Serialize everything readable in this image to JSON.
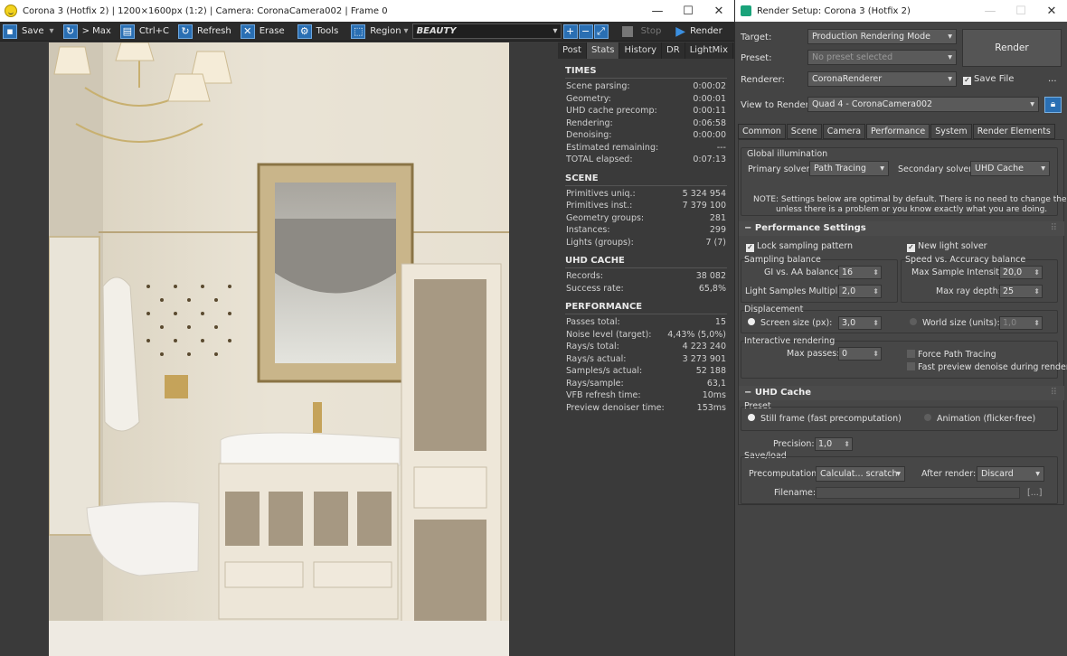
{
  "vfb": {
    "title": "Corona 3 (Hotfix 2) | 1200×1600px (1:2) | Camera: CoronaCamera002 | Frame 0",
    "toolbar": {
      "save": "Save",
      "max": "> Max",
      "copy": "Ctrl+C",
      "refresh": "Refresh",
      "erase": "Erase",
      "tools": "Tools",
      "region": "Region",
      "channel": "BEAUTY",
      "stop": "Stop",
      "render": "Render"
    },
    "tabs": [
      "Post",
      "Stats",
      "History",
      "DR",
      "LightMix"
    ],
    "sections": [
      {
        "title": "TIMES",
        "rows": [
          [
            "Scene parsing:",
            "0:00:02"
          ],
          [
            "Geometry:",
            "0:00:01"
          ],
          [
            "UHD cache precomp:",
            "0:00:11"
          ],
          [
            "Rendering:",
            "0:06:58"
          ],
          [
            "Denoising:",
            "0:00:00"
          ],
          [
            "Estimated remaining:",
            "---"
          ],
          [
            "TOTAL elapsed:",
            "0:07:13"
          ]
        ]
      },
      {
        "title": "SCENE",
        "rows": [
          [
            "Primitives uniq.:",
            "5 324 954"
          ],
          [
            "Primitives inst.:",
            "7 379 100"
          ],
          [
            "Geometry groups:",
            "281"
          ],
          [
            "Instances:",
            "299"
          ],
          [
            "Lights (groups):",
            "7 (7)"
          ]
        ]
      },
      {
        "title": "UHD CACHE",
        "rows": [
          [
            "Records:",
            "38 082"
          ],
          [
            "Success rate:",
            "65,8%"
          ]
        ]
      },
      {
        "title": "PERFORMANCE",
        "rows": [
          [
            "Passes total:",
            "15"
          ],
          [
            "Noise level (target):",
            "4,43% (5,0%)"
          ],
          [
            "Rays/s total:",
            "4 223 240"
          ],
          [
            "Rays/s actual:",
            "3 273 901"
          ],
          [
            "Samples/s actual:",
            "52 188"
          ],
          [
            "Rays/sample:",
            "63,1"
          ],
          [
            "VFB refresh time:",
            "10ms"
          ],
          [
            "Preview denoiser time:",
            "153ms"
          ]
        ]
      }
    ]
  },
  "rs": {
    "title": "Render Setup: Corona 3 (Hotfix 2)",
    "target_label": "Target:",
    "target": "Production Rendering Mode",
    "preset_label": "Preset:",
    "preset": "No preset selected",
    "renderer_label": "Renderer:",
    "renderer": "CoronaRenderer",
    "savefile": "Save File",
    "more": "...",
    "view_label": "View to Render:",
    "view": "Quad 4 - CoronaCamera002",
    "render_btn": "Render",
    "tabs": [
      "Common",
      "Scene",
      "Camera",
      "Performance",
      "System",
      "Render Elements"
    ],
    "gi": {
      "title": "Global illumination",
      "primary_label": "Primary solver:",
      "primary": "Path Tracing",
      "secondary_label": "Secondary solver:",
      "secondary": "UHD Cache",
      "note1": "NOTE: Settings below are optimal by default. There is no need to change them",
      "note2": "unless there is a problem or you know exactly what you are doing."
    },
    "perf": {
      "title": "Performance Settings",
      "lock": "Lock sampling pattern",
      "newlight": "New light solver",
      "sb": "Sampling balance",
      "sva": "Speed vs. Accuracy balance",
      "gi_aa_label": "GI vs. AA balance:",
      "gi_aa": "16",
      "maxint_label": "Max Sample Intensity:",
      "maxint": "20,0",
      "lsm_label": "Light Samples Multiplier:",
      "lsm": "2,0",
      "maxray_label": "Max ray depth:",
      "maxray": "25",
      "disp": "Displacement",
      "screen_label": "Screen size (px):",
      "screen": "3,0",
      "world_label": "World size (units):",
      "world": "1,0",
      "ir": "Interactive rendering",
      "maxpass_label": "Max passes:",
      "maxpass": "0",
      "force": "Force Path Tracing",
      "fastprev": "Fast preview denoise during render"
    },
    "uhd": {
      "title": "UHD Cache",
      "preset": "Preset",
      "still": "Still frame (fast precomputation)",
      "anim": "Animation (flicker-free)",
      "prec_label": "Precision:",
      "prec": "1,0",
      "saveload": "Save/load",
      "precomp_label": "Precomputation:",
      "precomp": "Calculat... scratch",
      "after_label": "After render:",
      "after": "Discard",
      "file_label": "Filename:",
      "browse": "[...]"
    }
  }
}
